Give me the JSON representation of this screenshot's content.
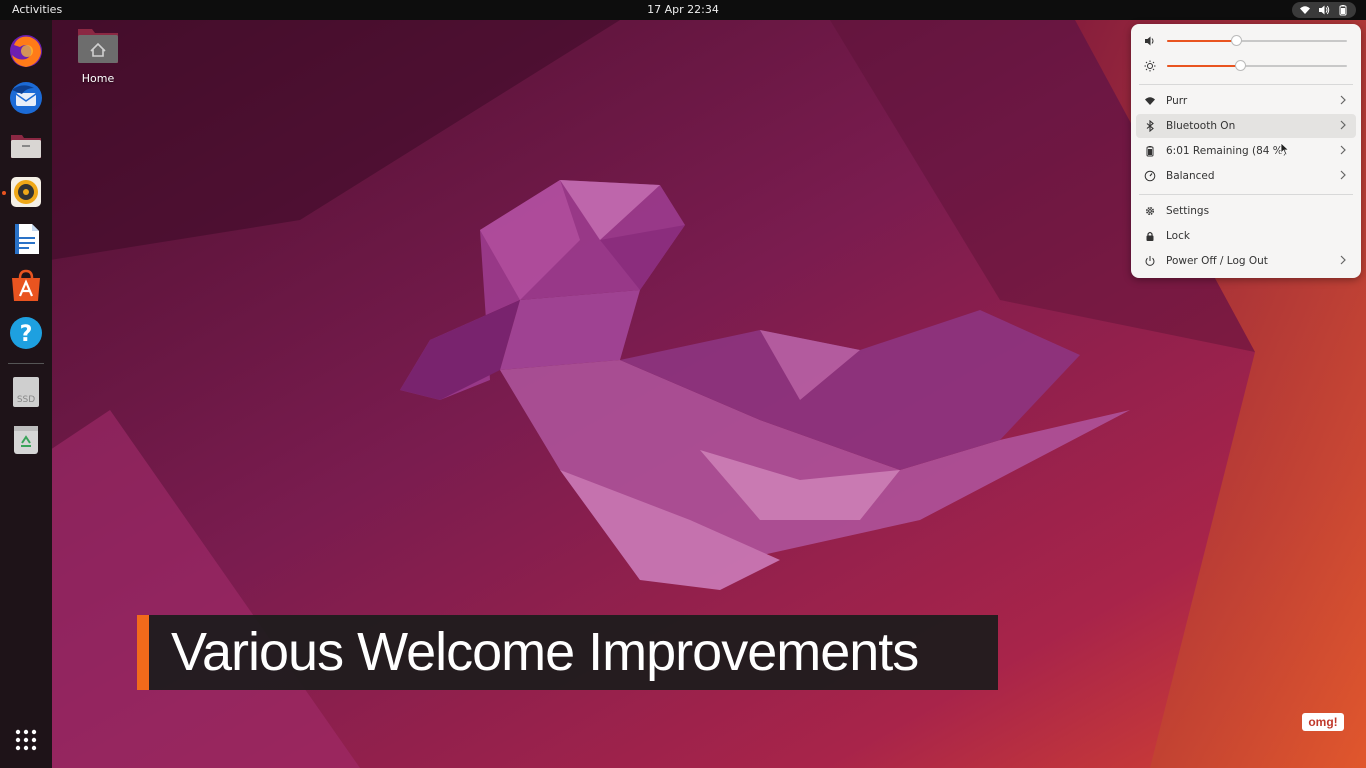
{
  "topbar": {
    "activities_label": "Activities",
    "clock": "17 Apr  22:34",
    "tray_icons": [
      "wifi-icon",
      "volume-icon",
      "battery-icon"
    ]
  },
  "dock": {
    "apps": [
      {
        "name": "Firefox",
        "icon": "firefox-icon"
      },
      {
        "name": "Thunderbird",
        "icon": "thunderbird-icon"
      },
      {
        "name": "Files",
        "icon": "files-icon"
      },
      {
        "name": "Rhythmbox",
        "icon": "rhythmbox-icon",
        "running": true
      },
      {
        "name": "LibreOffice Writer",
        "icon": "writer-icon"
      },
      {
        "name": "Ubuntu Software",
        "icon": "software-icon"
      },
      {
        "name": "Help",
        "icon": "help-icon"
      },
      {
        "name": "SSD",
        "icon": "ssd-drive-icon"
      },
      {
        "name": "Trash",
        "icon": "trash-icon"
      }
    ],
    "ssd_label": "SSD",
    "show_apps_icon": "app-grid-icon"
  },
  "desktop": {
    "home_label": "Home"
  },
  "quick_settings": {
    "volume_level": 0.39,
    "brightness_level": 0.41,
    "items": [
      {
        "label": "Purr",
        "icon": "wifi-icon",
        "chevron": true
      },
      {
        "label": "Bluetooth On",
        "icon": "bluetooth-icon",
        "chevron": true,
        "hover": true
      },
      {
        "label": "6:01 Remaining (84 %)",
        "icon": "battery-icon",
        "chevron": true
      },
      {
        "label": "Balanced",
        "icon": "power-mode-icon",
        "chevron": true
      }
    ],
    "actions": [
      {
        "label": "Settings",
        "icon": "gear-icon",
        "chevron": false
      },
      {
        "label": "Lock",
        "icon": "lock-icon",
        "chevron": false
      },
      {
        "label": "Power Off / Log Out",
        "icon": "power-icon",
        "chevron": true
      }
    ]
  },
  "caption": {
    "text": "Various Welcome Improvements"
  },
  "watermark": {
    "text": "omg!"
  },
  "colors": {
    "accent": "#e95420",
    "caption_bar": "#f26a1b",
    "topbar": "#0d0d0d",
    "dock": "#1e1318",
    "menu_bg": "#f6f5f4"
  }
}
